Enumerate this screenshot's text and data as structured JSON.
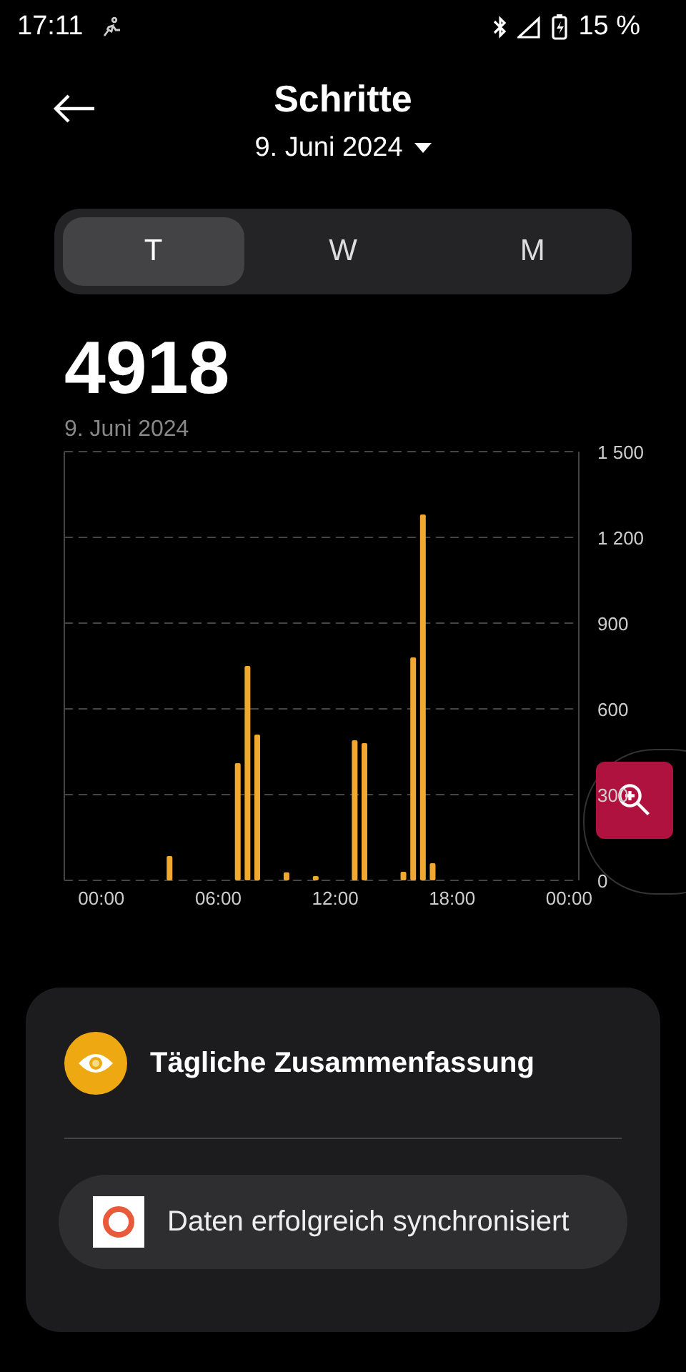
{
  "status_bar": {
    "time": "17:11",
    "battery": "15 %"
  },
  "header": {
    "title": "Schritte",
    "date": "9. Juni 2024"
  },
  "tabs": [
    {
      "label": "T",
      "selected": true
    },
    {
      "label": "W",
      "selected": false
    },
    {
      "label": "M",
      "selected": false
    }
  ],
  "summary": {
    "value": "4918",
    "date": "9. Juni 2024"
  },
  "chart_data": {
    "type": "bar",
    "x": [
      3.5,
      7,
      7.5,
      8,
      9.5,
      11,
      13,
      13.5,
      15.5,
      16,
      16.5,
      17
    ],
    "series": [
      {
        "color": "#f0a830",
        "values": [
          85,
          410,
          750,
          510,
          28,
          15,
          490,
          480,
          30,
          780,
          1280,
          60
        ]
      }
    ],
    "grid": true,
    "xlim": [
      -1.9,
      24.5
    ],
    "ylim": [
      0,
      1500
    ],
    "xticks": [
      {
        "value": 0,
        "label": "00:00"
      },
      {
        "value": 6,
        "label": "06:00"
      },
      {
        "value": 12,
        "label": "12:00"
      },
      {
        "value": 18,
        "label": "18:00"
      },
      {
        "value": 24,
        "label": "00:00"
      }
    ],
    "yticks": [
      {
        "value": 0,
        "label": "0"
      },
      {
        "value": 300,
        "label": "300"
      },
      {
        "value": 600,
        "label": "600"
      },
      {
        "value": 900,
        "label": "900"
      },
      {
        "value": 1200,
        "label": "1 200"
      },
      {
        "value": 1500,
        "label": "1 500"
      }
    ]
  },
  "card": {
    "title": "Tägliche Zusammenfassung"
  },
  "toast": {
    "message": "Daten erfolgreich synchronisiert"
  }
}
